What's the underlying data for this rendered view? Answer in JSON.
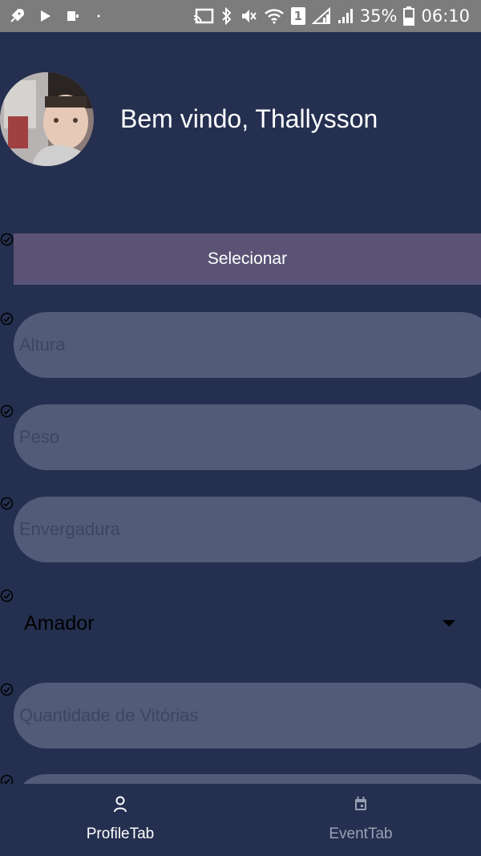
{
  "status_bar": {
    "battery_percent": "35%",
    "time": "06:10",
    "sim_badge": "1",
    "left_icons": [
      "rocket-icon",
      "play-icon",
      "app-notification-icon",
      "dot-icon"
    ],
    "right_icons": [
      "cast-icon",
      "bluetooth-icon",
      "mute-icon",
      "wifi-icon",
      "sim-icon",
      "signal-icon",
      "signal-icon",
      "battery-icon"
    ]
  },
  "header": {
    "welcome_text": "Bem vindo, Thallysson"
  },
  "form": {
    "select_label": "Selecionar",
    "altura_placeholder": "Altura",
    "peso_placeholder": "Peso",
    "envergadura_placeholder": "Envergadura",
    "category_value": "Amador",
    "vitorias_placeholder": "Quantidade de Vitórias"
  },
  "tabs": [
    {
      "label": "ProfileTab",
      "icon": "person-icon",
      "active": true
    },
    {
      "label": "EventTab",
      "icon": "calendar-icon",
      "active": false
    }
  ],
  "colors": {
    "background": "#253050",
    "field": "#525b77",
    "select_button": "#5b5375",
    "active_tab": "#ffffff",
    "inactive_tab": "#9aa0b4"
  }
}
